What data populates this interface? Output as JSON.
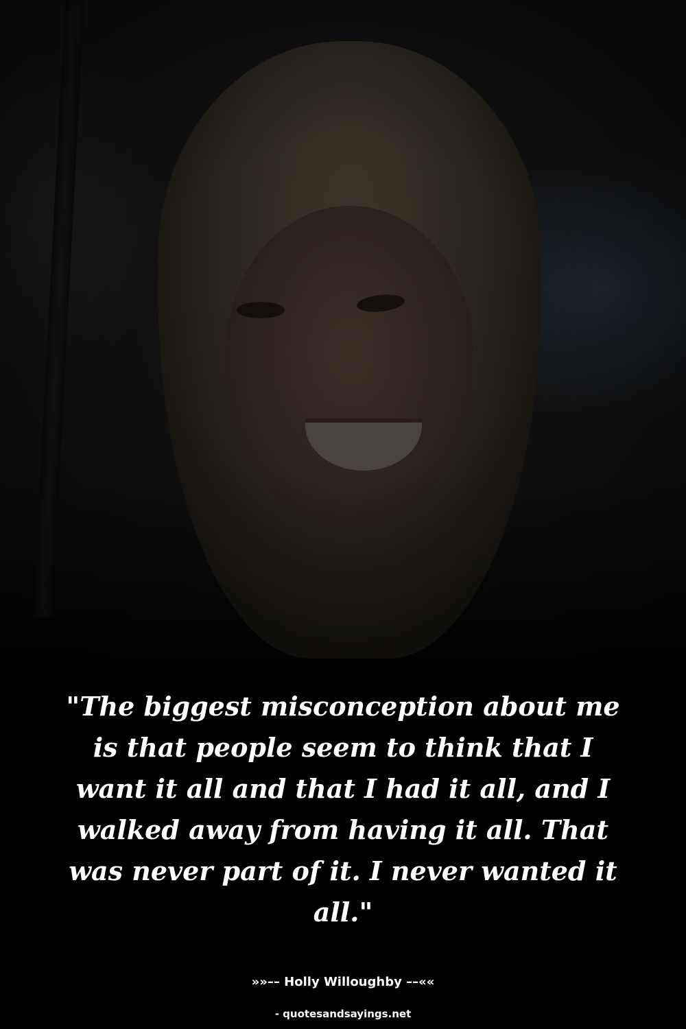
{
  "quote": {
    "text": "\"The biggest misconception about me is that people seem to think that I want it all and that I had it all, and I walked away from having it all. That was never part of it. I never wanted it all.\""
  },
  "author": {
    "line": "»»–– Holly Willoughby ––««"
  },
  "source": {
    "text": "- quotesandsayings.net"
  },
  "colors": {
    "background": "#000000",
    "text": "#ffffff"
  }
}
